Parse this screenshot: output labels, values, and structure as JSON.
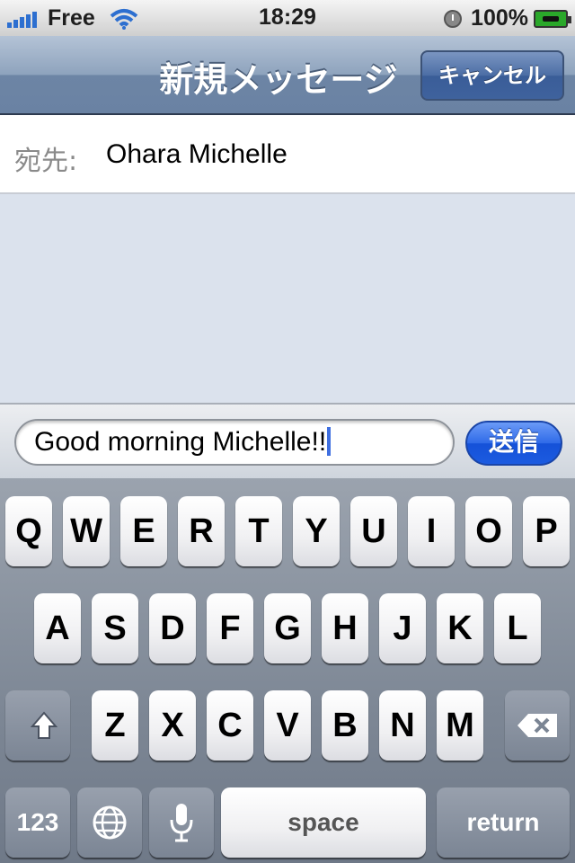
{
  "status_bar": {
    "carrier": "Free",
    "time": "18:29",
    "battery": "100%",
    "icons": [
      "signal-icon",
      "wifi-icon",
      "alarm-icon",
      "battery-charging-icon"
    ]
  },
  "nav": {
    "title": "新規メッセージ",
    "cancel_label": "キャンセル"
  },
  "recipient": {
    "to_label": "宛先:",
    "name": "Ohara Michelle"
  },
  "compose": {
    "message": "Good morning Michelle!!",
    "send_label": "送信"
  },
  "keyboard": {
    "row1": [
      "Q",
      "W",
      "E",
      "R",
      "T",
      "Y",
      "U",
      "I",
      "O",
      "P"
    ],
    "row2": [
      "A",
      "S",
      "D",
      "F",
      "G",
      "H",
      "J",
      "K",
      "L"
    ],
    "row3": [
      "Z",
      "X",
      "C",
      "V",
      "B",
      "N",
      "M"
    ],
    "numbers_label": "123",
    "space_label": "space",
    "return_label": "return",
    "icons": [
      "shift-icon",
      "backspace-icon",
      "globe-icon",
      "microphone-icon"
    ]
  },
  "colors": {
    "nav_bar": "#7f95b3",
    "send_button": "#2a64e4",
    "conversation_bg": "#dbe2ed",
    "cursor": "#3f6fe0"
  }
}
